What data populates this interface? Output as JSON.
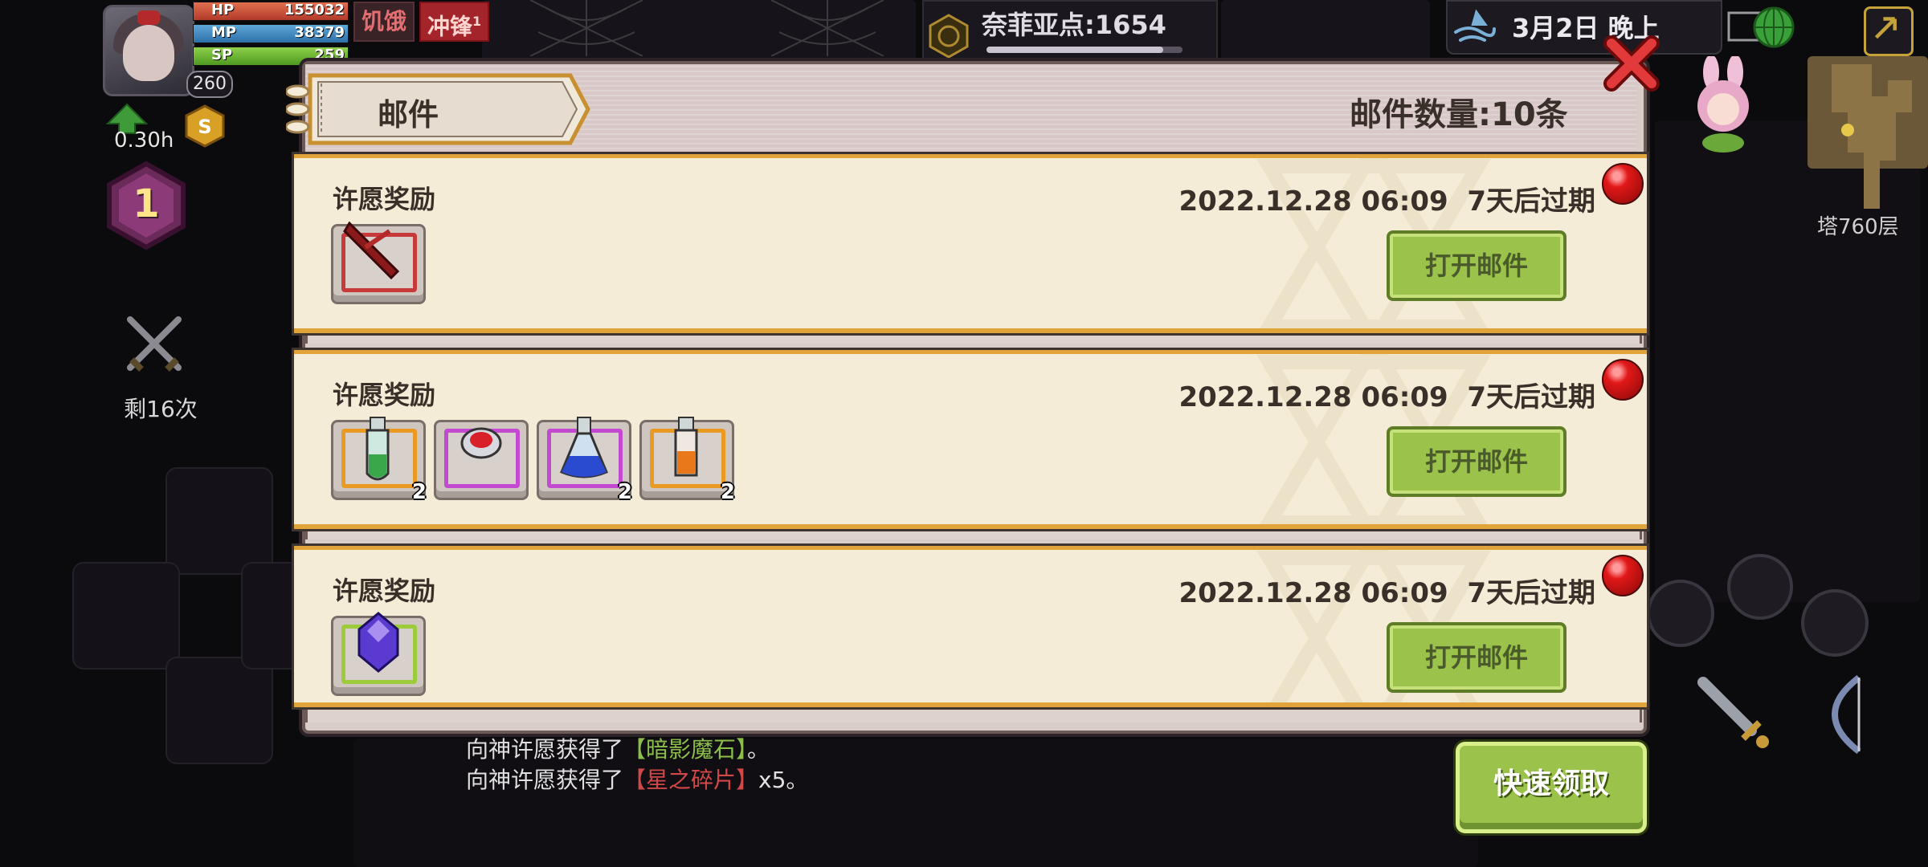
{
  "hud": {
    "hp_label": "HP",
    "hp_value": "155032",
    "mp_label": "MP",
    "mp_value": "38379",
    "sp_label": "SP",
    "sp_value": "259",
    "level": "260",
    "status_hunger": "饥饿",
    "status_charge": "冲锋",
    "status_charge_sup": "1",
    "timer": "0.30h",
    "floor": "1",
    "remaining": "剩16次"
  },
  "topbar": {
    "nafi_points": "奈菲亚点:1654",
    "nafi_progress": 0.9,
    "date": "3月2日  晚上"
  },
  "right": {
    "tower_floor": "塔760层",
    "quick_claim": "快速领取"
  },
  "chat": [
    {
      "prefix": "向神许愿获得了",
      "item": "【暗影魔石】",
      "suffix": "。",
      "color": "#8bbf4a"
    },
    {
      "prefix": "向神许愿获得了",
      "item": "【星之碎片】",
      "suffix": "x5。",
      "color": "#d04848"
    }
  ],
  "mail": {
    "title": "邮件",
    "count": "邮件数量:10条",
    "items": [
      {
        "title": "许愿奖励",
        "date": "2022.12.28 06:09  7天后过期",
        "button": "打开邮件",
        "rewards": [
          {
            "icon": "red-blade-icon",
            "border": "#c83a3a",
            "count": ""
          }
        ]
      },
      {
        "title": "许愿奖励",
        "date": "2022.12.28 06:09  7天后过期",
        "button": "打开邮件",
        "rewards": [
          {
            "icon": "green-potion-icon",
            "border": "#e89a22",
            "count": "2"
          },
          {
            "icon": "red-orb-icon",
            "border": "#c24ad0",
            "count": ""
          },
          {
            "icon": "blue-flask-icon",
            "border": "#c24ad0",
            "count": "2"
          },
          {
            "icon": "orange-potion-icon",
            "border": "#e89a22",
            "count": "2"
          }
        ]
      },
      {
        "title": "许愿奖励",
        "date": "2022.12.28 06:09  7天后过期",
        "button": "打开邮件",
        "rewards": [
          {
            "icon": "purple-crystal-icon",
            "border": "#9ccc3a",
            "count": ""
          }
        ]
      }
    ]
  }
}
